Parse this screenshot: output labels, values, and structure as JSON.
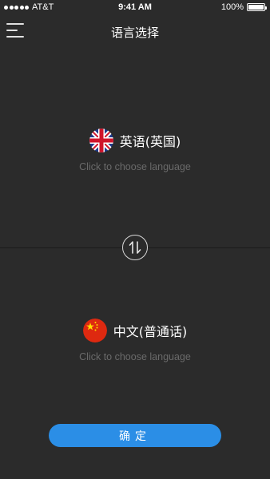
{
  "status_bar": {
    "carrier": "AT&T",
    "time": "9:41 AM",
    "battery": "100%",
    "battery_level": 1.0
  },
  "header": {
    "title": "语言选择",
    "menu_icon": "hamburger-menu-icon"
  },
  "source_language": {
    "flag_icon": "uk-flag-icon",
    "name": "英语(英国)",
    "hint": "Click to choose language"
  },
  "swap": {
    "icon": "swap-vertical-arrows-icon"
  },
  "target_language": {
    "flag_icon": "china-flag-icon",
    "name": "中文(普通话)",
    "hint": "Click to choose language"
  },
  "confirm": {
    "label": "确定"
  },
  "colors": {
    "background": "#2b2b2b",
    "accent": "#2b8ee6",
    "hint_text": "#6a6a6a"
  }
}
